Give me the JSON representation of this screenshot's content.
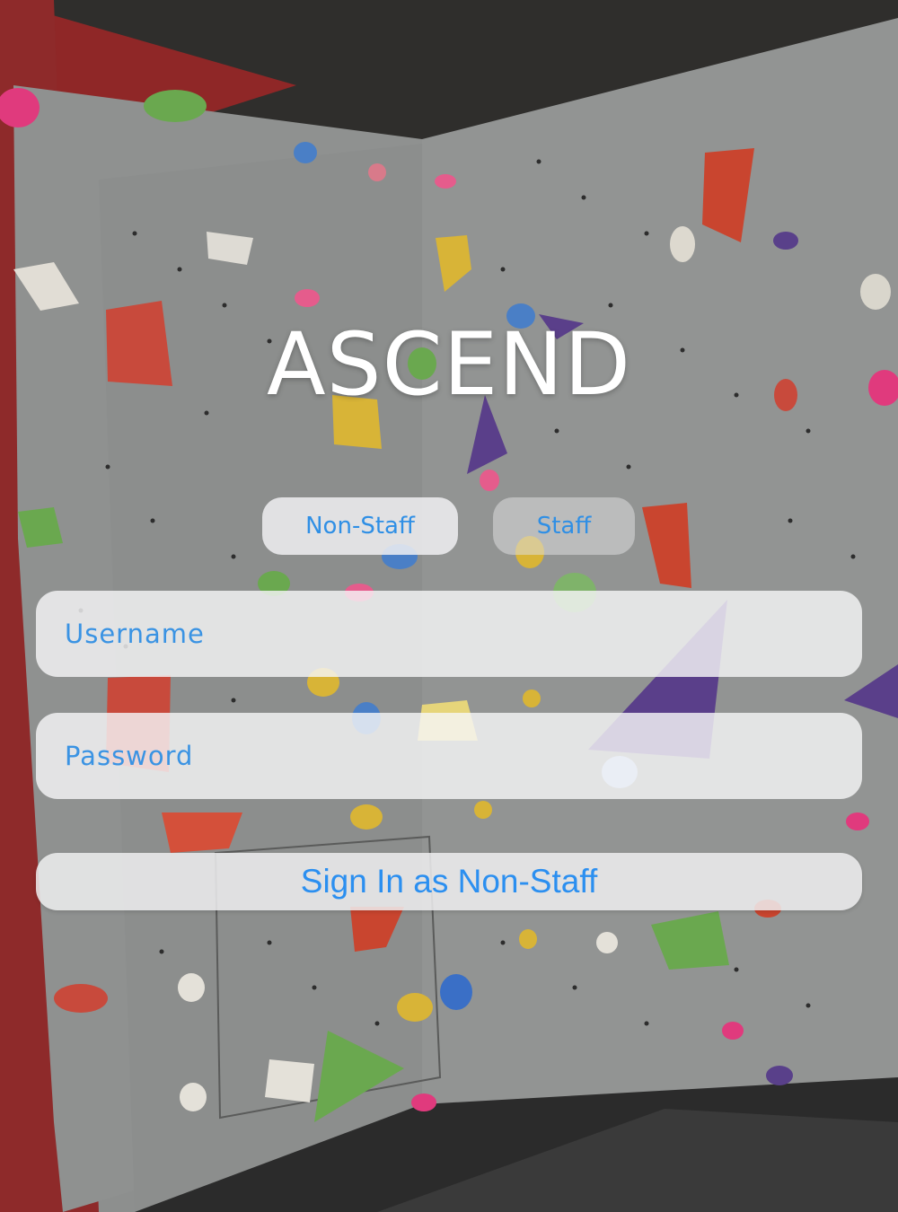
{
  "app": {
    "title": "ASCEND"
  },
  "role_toggle": {
    "options": [
      "Non-Staff",
      "Staff"
    ],
    "selected": "Non-Staff"
  },
  "form": {
    "username_placeholder": "Username",
    "password_placeholder": "Password",
    "signin_label": "Sign In as Non-Staff"
  },
  "colors": {
    "accent": "#2f8fe5",
    "title": "#ffffff",
    "wall": "#8d8f8e",
    "red_trim": "#9b2b2b"
  }
}
